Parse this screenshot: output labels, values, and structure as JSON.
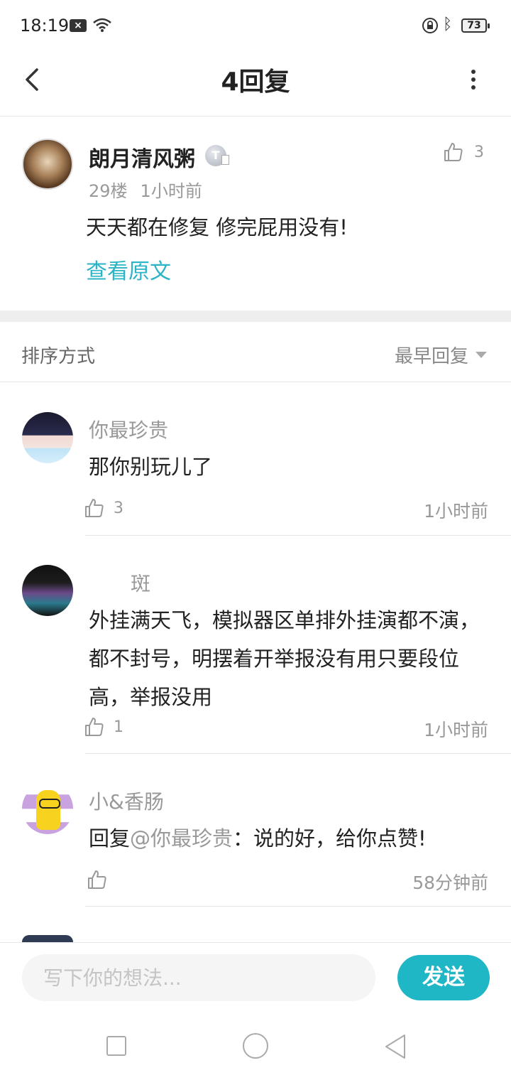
{
  "status_bar": {
    "time": "18:19",
    "notification_icon": "x-box-icon",
    "battery": "73"
  },
  "header": {
    "title": "4回复"
  },
  "main_post": {
    "author": "朗月清风粥",
    "badge": "T",
    "floor": "29楼",
    "time": "1小时前",
    "content": "天天都在修复 修完屁用没有!",
    "view_original": "查看原文",
    "likes": "3"
  },
  "sort": {
    "label": "排序方式",
    "selected": "最早回复"
  },
  "replies": [
    {
      "author": "你最珍贵",
      "content": "那你别玩儿了",
      "likes": "3",
      "time": "1小时前"
    },
    {
      "author": "斑",
      "content": "外挂满天飞，模拟器区单排外挂演都不演，都不封号，明摆着开举报没有用只要段位高，举报没用",
      "likes": "1",
      "time": "1小时前"
    },
    {
      "author": "小&香肠",
      "content_prefix": "回复",
      "mention": "@你最珍贵",
      "content": "：说的好，给你点赞!",
      "likes": "",
      "time": "58分钟前"
    }
  ],
  "input": {
    "placeholder": "写下你的想法...",
    "send_label": "发送"
  },
  "colors": {
    "accent": "#1fb6c5",
    "link": "#2ab4c6"
  }
}
